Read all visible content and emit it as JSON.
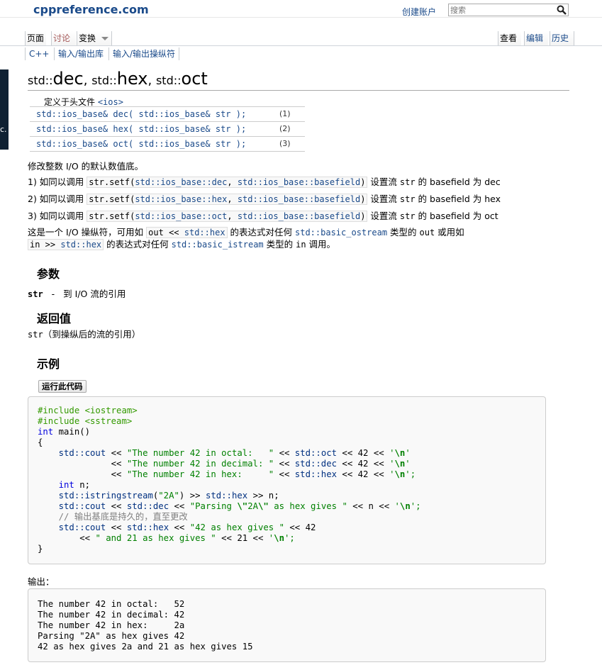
{
  "header": {
    "site_name": "cppreference.com",
    "create_account": "创建账户",
    "search_placeholder": "搜索"
  },
  "tabs": {
    "left": [
      "页面",
      "讨论",
      "变换"
    ],
    "right": [
      "查看",
      "编辑",
      "历史"
    ]
  },
  "breadcrumb": [
    "C++",
    "输入/输出库",
    "输入/输出操纵符"
  ],
  "side_fragment": "c.",
  "title": {
    "ns1": "std::",
    "n1": "dec",
    "sep1": ", ",
    "ns2": "std::",
    "n2": "hex",
    "sep2": ", ",
    "ns3": "std::",
    "n3": "oct"
  },
  "declaration": {
    "defined_in_label": "定义于头文件 ",
    "header": "<ios>",
    "rows": [
      {
        "sig": "std::ios_base& dec( std::ios_base& str );",
        "num": "(1)"
      },
      {
        "sig": "std::ios_base& hex( std::ios_base& str );",
        "num": "(2)"
      },
      {
        "sig": "std::ios_base& oct( std::ios_base& str );",
        "num": "(3)"
      }
    ]
  },
  "description": {
    "intro": "修改整数 I/O 的默认数值底。",
    "items": [
      {
        "prefix": "1) 如同以调用 ",
        "code_a": "str.setf(",
        "code_b": "std::ios_base::dec",
        "code_c": ", ",
        "code_d": "std::ios_base::basefield",
        "code_e": ")",
        "mid": " 设置流 ",
        "str": "str",
        "suffix": " 的 basefield 为 dec"
      },
      {
        "prefix": "2) 如同以调用 ",
        "code_a": "str.setf(",
        "code_b": "std::ios_base::hex",
        "code_c": ", ",
        "code_d": "std::ios_base::basefield",
        "code_e": ")",
        "mid": " 设置流 ",
        "str": "str",
        "suffix": " 的 basefield 为 hex"
      },
      {
        "prefix": "3) 如同以调用 ",
        "code_a": "str.setf(",
        "code_b": "std::ios_base::oct",
        "code_c": ", ",
        "code_d": "std::ios_base::basefield",
        "code_e": ")",
        "mid": " 设置流 ",
        "str": "str",
        "suffix": " 的 basefield 为 oct"
      }
    ],
    "manip_a": "这是一个 I/O 操纵符，可用如 ",
    "manip_code1a": "out << ",
    "manip_code1b": "std::hex",
    "manip_b": " 的表达式对任何 ",
    "manip_link1": "std::basic_ostream",
    "manip_c": " 类型的 ",
    "manip_out": "out",
    "manip_d": " 或用如",
    "manip_code2a": "in >> ",
    "manip_code2b": "std::hex",
    "manip_e": " 的表达式对任何 ",
    "manip_link2": "std::basic_istream",
    "manip_f": " 类型的 ",
    "manip_in": "in",
    "manip_g": " 调用。"
  },
  "params": {
    "heading": "参数",
    "name": "str",
    "dash": "-",
    "desc": "到 I/O 流的引用"
  },
  "returns": {
    "heading": "返回值",
    "code": "str",
    "text": "（到操纵后的流的引用）"
  },
  "example": {
    "heading": "示例",
    "run_label": "运行此代码",
    "output_label": "输出：",
    "output": "The number 42 in octal:   52\nThe number 42 in decimal: 42\nThe number 42 in hex:     2a\nParsing \"2A\" as hex gives 42\n42 as hex gives 2a and 21 as hex gives 15"
  },
  "code": {
    "l1": "#include <iostream>",
    "l2": "#include <sstream>",
    "l3a": "int",
    "l3b": " main()",
    "l4": "{",
    "l5a": "    std::cout",
    "l5b": " << ",
    "l5c": "\"The number 42 in octal:   \"",
    "l5d": " << ",
    "l5e": "std::oct",
    "l5f": " << ",
    "l5g": "42",
    "l5h": " << ",
    "l5i": "'",
    "l5j": "\\n",
    "l5k": "'",
    "l6a": "              << ",
    "l6c": "\"The number 42 in decimal: \"",
    "l6d": " << ",
    "l6e": "std::dec",
    "l6f": " << ",
    "l6g": "42",
    "l6h": " << ",
    "l6i": "'",
    "l6j": "\\n",
    "l6k": "'",
    "l7a": "              << ",
    "l7c": "\"The number 42 in hex:     \"",
    "l7d": " << ",
    "l7e": "std::hex",
    "l7f": " << ",
    "l7g": "42",
    "l7h": " << ",
    "l7i": "'",
    "l7j": "\\n",
    "l7k": "';",
    "l8a": "    int",
    "l8b": " n;",
    "l9a": "    std::istringstream",
    "l9b": "(",
    "l9c": "\"2A\"",
    "l9d": ") >> ",
    "l9e": "std::hex",
    "l9f": " >> n;",
    "l10a": "    std::cout",
    "l10b": " << ",
    "l10c": "std::dec",
    "l10d": " << ",
    "l10e": "\"Parsing ",
    "l10f": "\\\"",
    "l10g": "2A",
    "l10h": "\\\"",
    "l10i": " as hex gives \"",
    "l10j": " << n << ",
    "l10k": "'",
    "l10l": "\\n",
    "l10m": "';",
    "l11": "    // 输出基底是持久的，直至更改",
    "l12a": "    std::cout",
    "l12b": " << ",
    "l12c": "std::hex",
    "l12d": " << ",
    "l12e": "\"42 as hex gives \"",
    "l12f": " << 42",
    "l13a": "        << ",
    "l13b": "\" and 21 as hex gives \"",
    "l13c": " << 21 << ",
    "l13d": "'",
    "l13e": "\\n",
    "l13f": "';",
    "l14": "}"
  }
}
